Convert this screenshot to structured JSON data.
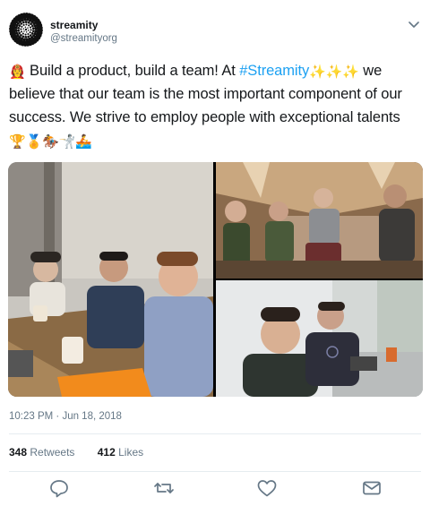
{
  "user": {
    "name": "streamity",
    "handle": "@streamityorg"
  },
  "tweet": {
    "text_before": " Build a product, build a team! At ",
    "hashtag": "#Streamity",
    "text_line2": " we believe that our team is the most important component of our success. We strive to employ people with exceptional talents",
    "emoji_lead": "👩‍🚒",
    "emoji_sparkles": "✨✨✨",
    "emoji_trail": "🏆🏅🏇🤺🚣"
  },
  "meta": {
    "timestamp": "10:23 PM · Jun 18, 2018"
  },
  "stats": {
    "retweets_count": "348",
    "retweets_label": "Retweets",
    "likes_count": "412",
    "likes_label": "Likes"
  },
  "icons": {
    "reply": "reply-icon",
    "retweet": "retweet-icon",
    "like": "heart-icon",
    "message": "mail-icon",
    "more": "chevron-down-icon"
  },
  "colors": {
    "accent": "#1da1f2",
    "secondary_text": "#657786",
    "icon": "#657786"
  }
}
